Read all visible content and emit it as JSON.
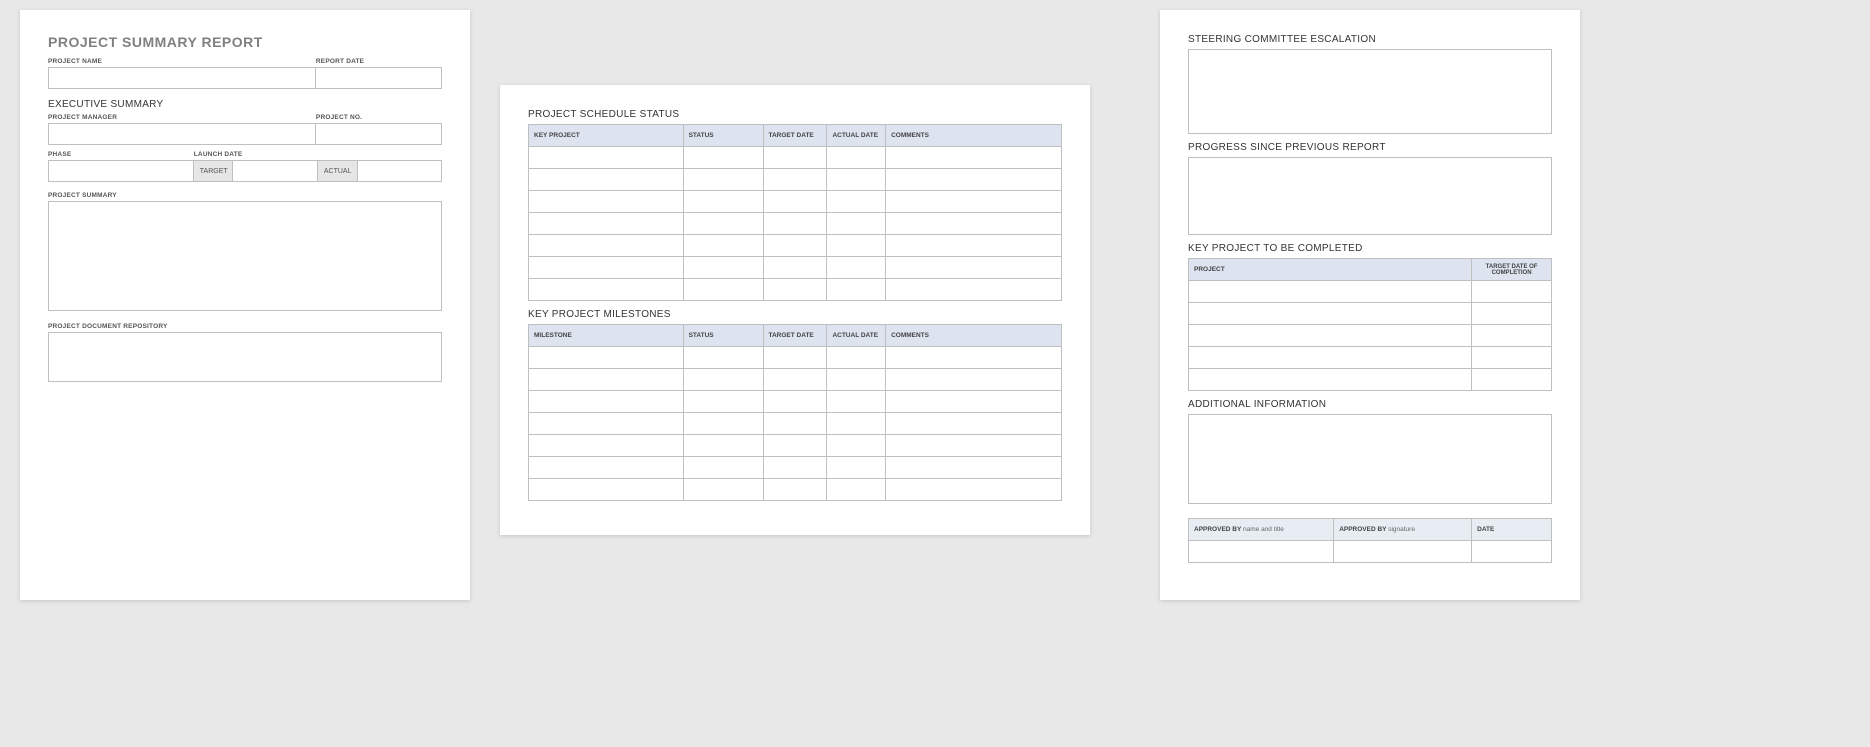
{
  "page1": {
    "title": "PROJECT SUMMARY REPORT",
    "labels": {
      "project_name": "PROJECT NAME",
      "report_date": "REPORT DATE",
      "executive_summary": "EXECUTIVE SUMMARY",
      "project_manager": "PROJECT MANAGER",
      "project_no": "PROJECT NO.",
      "phase": "PHASE",
      "launch_date": "LAUNCH DATE",
      "target": "TARGET",
      "actual": "ACTUAL",
      "project_summary": "PROJECT SUMMARY",
      "project_document_repository": "PROJECT DOCUMENT REPOSITORY"
    }
  },
  "page2": {
    "schedule_heading": "PROJECT SCHEDULE STATUS",
    "milestones_heading": "KEY PROJECT MILESTONES",
    "cols": {
      "key_project": "KEY PROJECT",
      "milestone": "MILESTONE",
      "status": "STATUS",
      "target_date": "TARGET DATE",
      "actual_date": "ACTUAL DATE",
      "comments": "COMMENTS"
    }
  },
  "page3": {
    "steering_heading": "STEERING COMMITTEE ESCALATION",
    "progress_heading": "PROGRESS SINCE PREVIOUS REPORT",
    "key_project_heading": "KEY PROJECT TO BE COMPLETED",
    "additional_heading": "ADDITIONAL INFORMATION",
    "cols": {
      "project": "PROJECT",
      "target_date_completion": "TARGET DATE OF COMPLETION"
    },
    "approval": {
      "approved_by_name_label": "APPROVED BY",
      "approved_by_name_hint": "name and title",
      "approved_by_sig_label": "APPROVED BY",
      "approved_by_sig_hint": "signature",
      "date": "DATE"
    }
  }
}
